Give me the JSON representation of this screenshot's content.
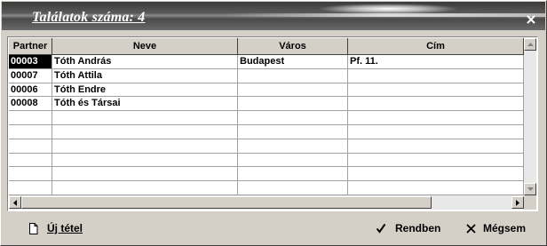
{
  "window": {
    "title": "Találatok száma: 4"
  },
  "grid": {
    "columns": [
      "Partner",
      "Neve",
      "Város",
      "Cím"
    ],
    "rows": [
      [
        "00003",
        "Tóth András",
        "Budapest",
        "Pf. 11."
      ],
      [
        "00007",
        "Tóth Attila",
        "",
        ""
      ],
      [
        "00006",
        "Tóth Endre",
        "",
        ""
      ],
      [
        "00008",
        "Tóth és Társai",
        "",
        ""
      ]
    ],
    "selected_row": 0
  },
  "buttons": {
    "new_item": "Új tétel",
    "ok": "Rendben",
    "cancel": "Mégsem"
  }
}
